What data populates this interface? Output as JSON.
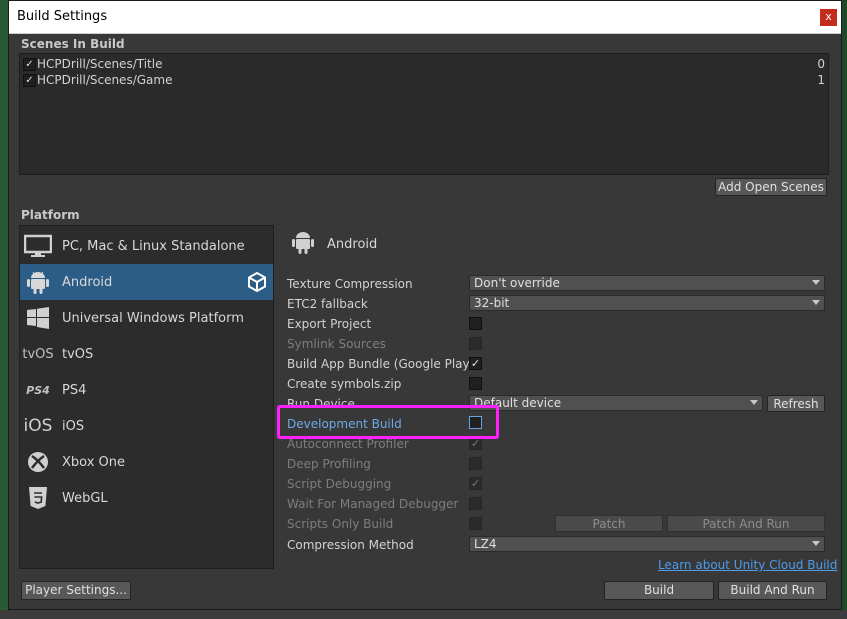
{
  "window": {
    "title": "Build Settings",
    "close_label": "x"
  },
  "scenes": {
    "section_label": "Scenes In Build",
    "items": [
      {
        "name": "HCPDrill/Scenes/Title",
        "index": "0",
        "checked": "✓"
      },
      {
        "name": "HCPDrill/Scenes/Game",
        "index": "1",
        "checked": "✓"
      }
    ],
    "add_open_scenes_label": "Add Open Scenes"
  },
  "platform": {
    "section_label": "Platform",
    "items": [
      {
        "label": "PC, Mac & Linux Standalone",
        "icon": "monitor-icon"
      },
      {
        "label": "Android",
        "icon": "android-icon",
        "selected": true
      },
      {
        "label": "Universal Windows Platform",
        "icon": "windows-icon"
      },
      {
        "label": "tvOS",
        "icon": "tvos-icon",
        "icon_text": "tvOS"
      },
      {
        "label": "PS4",
        "icon": "ps4-icon",
        "icon_text": "PS4"
      },
      {
        "label": "iOS",
        "icon": "ios-icon",
        "icon_text": "iOS"
      },
      {
        "label": "Xbox One",
        "icon": "xbox-icon"
      },
      {
        "label": "WebGL",
        "icon": "html5-icon",
        "icon_text": "HTML"
      }
    ]
  },
  "settings": {
    "header": "Android",
    "texture_compression": {
      "label": "Texture Compression",
      "value": "Don't override"
    },
    "etc2_fallback": {
      "label": "ETC2 fallback",
      "value": "32-bit"
    },
    "export_project": {
      "label": "Export Project"
    },
    "symlink_sources": {
      "label": "Symlink Sources"
    },
    "build_app_bundle": {
      "label": "Build App Bundle (Google Play)",
      "checked": "✓"
    },
    "create_symbols": {
      "label": "Create symbols.zip"
    },
    "run_device": {
      "label": "Run Device",
      "value": "Default device",
      "refresh_label": "Refresh"
    },
    "development_build": {
      "label": "Development Build"
    },
    "autoconnect_profiler": {
      "label": "Autoconnect Profiler",
      "checked": "✓"
    },
    "deep_profiling": {
      "label": "Deep Profiling"
    },
    "script_debugging": {
      "label": "Script Debugging",
      "checked": "✓"
    },
    "wait_for_debugger": {
      "label": "Wait For Managed Debugger"
    },
    "scripts_only_build": {
      "label": "Scripts Only Build",
      "patch_label": "Patch",
      "patch_and_run_label": "Patch And Run"
    },
    "compression_method": {
      "label": "Compression Method",
      "value": "LZ4"
    }
  },
  "footer": {
    "cloud_link": "Learn about Unity Cloud Build",
    "player_settings_label": "Player Settings...",
    "build_label": "Build",
    "build_and_run_label": "Build And Run"
  },
  "colors": {
    "selected": "#2c5d87",
    "highlight": "#ff20ff",
    "link": "#4e9bea"
  }
}
